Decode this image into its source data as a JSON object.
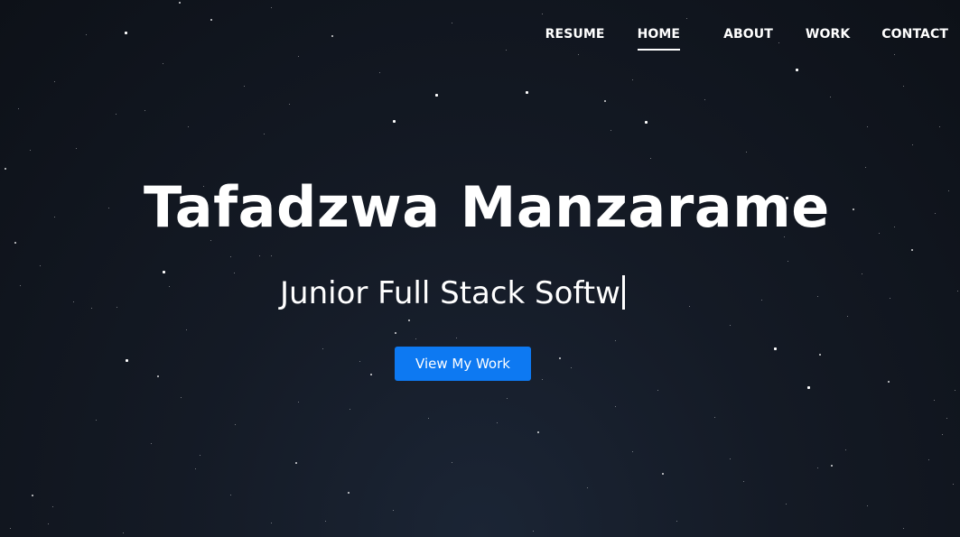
{
  "nav": {
    "items": [
      {
        "label": "RESUME",
        "active": false
      },
      {
        "label": "HOME",
        "active": true
      },
      {
        "label": "ABOUT",
        "active": false
      },
      {
        "label": "WORK",
        "active": false
      },
      {
        "label": "CONTACT",
        "active": false
      }
    ]
  },
  "hero": {
    "title": "Tafadzwa Manzarame",
    "subtitle": "Junior Full Stack Softw",
    "cta_label": "View My Work"
  },
  "colors": {
    "background": "#141a25",
    "accent": "#0d79f2",
    "text": "#ffffff"
  }
}
